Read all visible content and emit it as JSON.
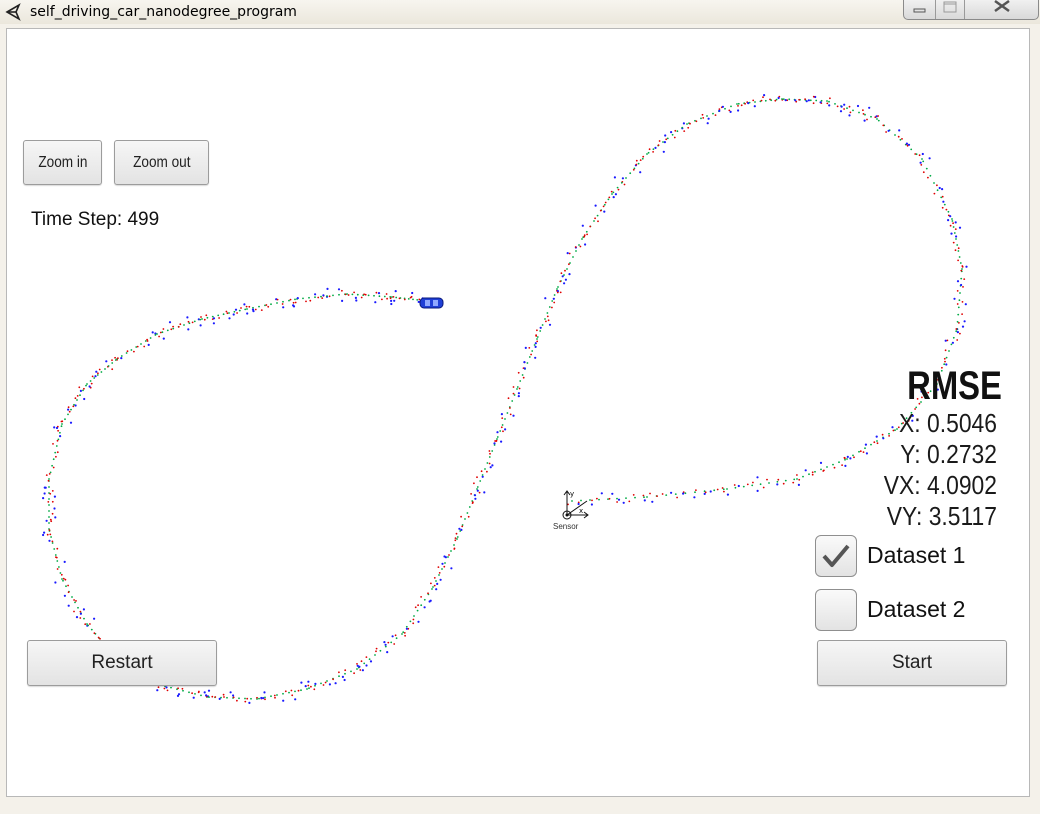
{
  "window": {
    "title": "self_driving_car_nanodegree_program",
    "app_icon": "unity-icon",
    "controls": [
      "minimize-icon",
      "maximize-icon",
      "close-icon"
    ]
  },
  "toolbar": {
    "zoom_in_label": "Zoom in",
    "zoom_out_label": "Zoom out"
  },
  "status": {
    "time_step": "Time Step: 499"
  },
  "rmse": {
    "title": "RMSE",
    "x": "X: 0.5046",
    "y": "Y: 0.2732",
    "vx": "VX: 4.0902",
    "vy": "VY: 3.5117"
  },
  "datasets": [
    {
      "label": "Dataset 1",
      "checked": true
    },
    {
      "label": "Dataset 2",
      "checked": false
    }
  ],
  "controls": {
    "restart_label": "Restart",
    "start_label": "Start"
  },
  "scene": {
    "sensor_label": "Sensor",
    "car_icon": "car-icon",
    "colors": {
      "estimate": "#00aa44",
      "lidar": "#e00000",
      "radar": "#1a1aff",
      "car": "#1f3fd6"
    }
  }
}
